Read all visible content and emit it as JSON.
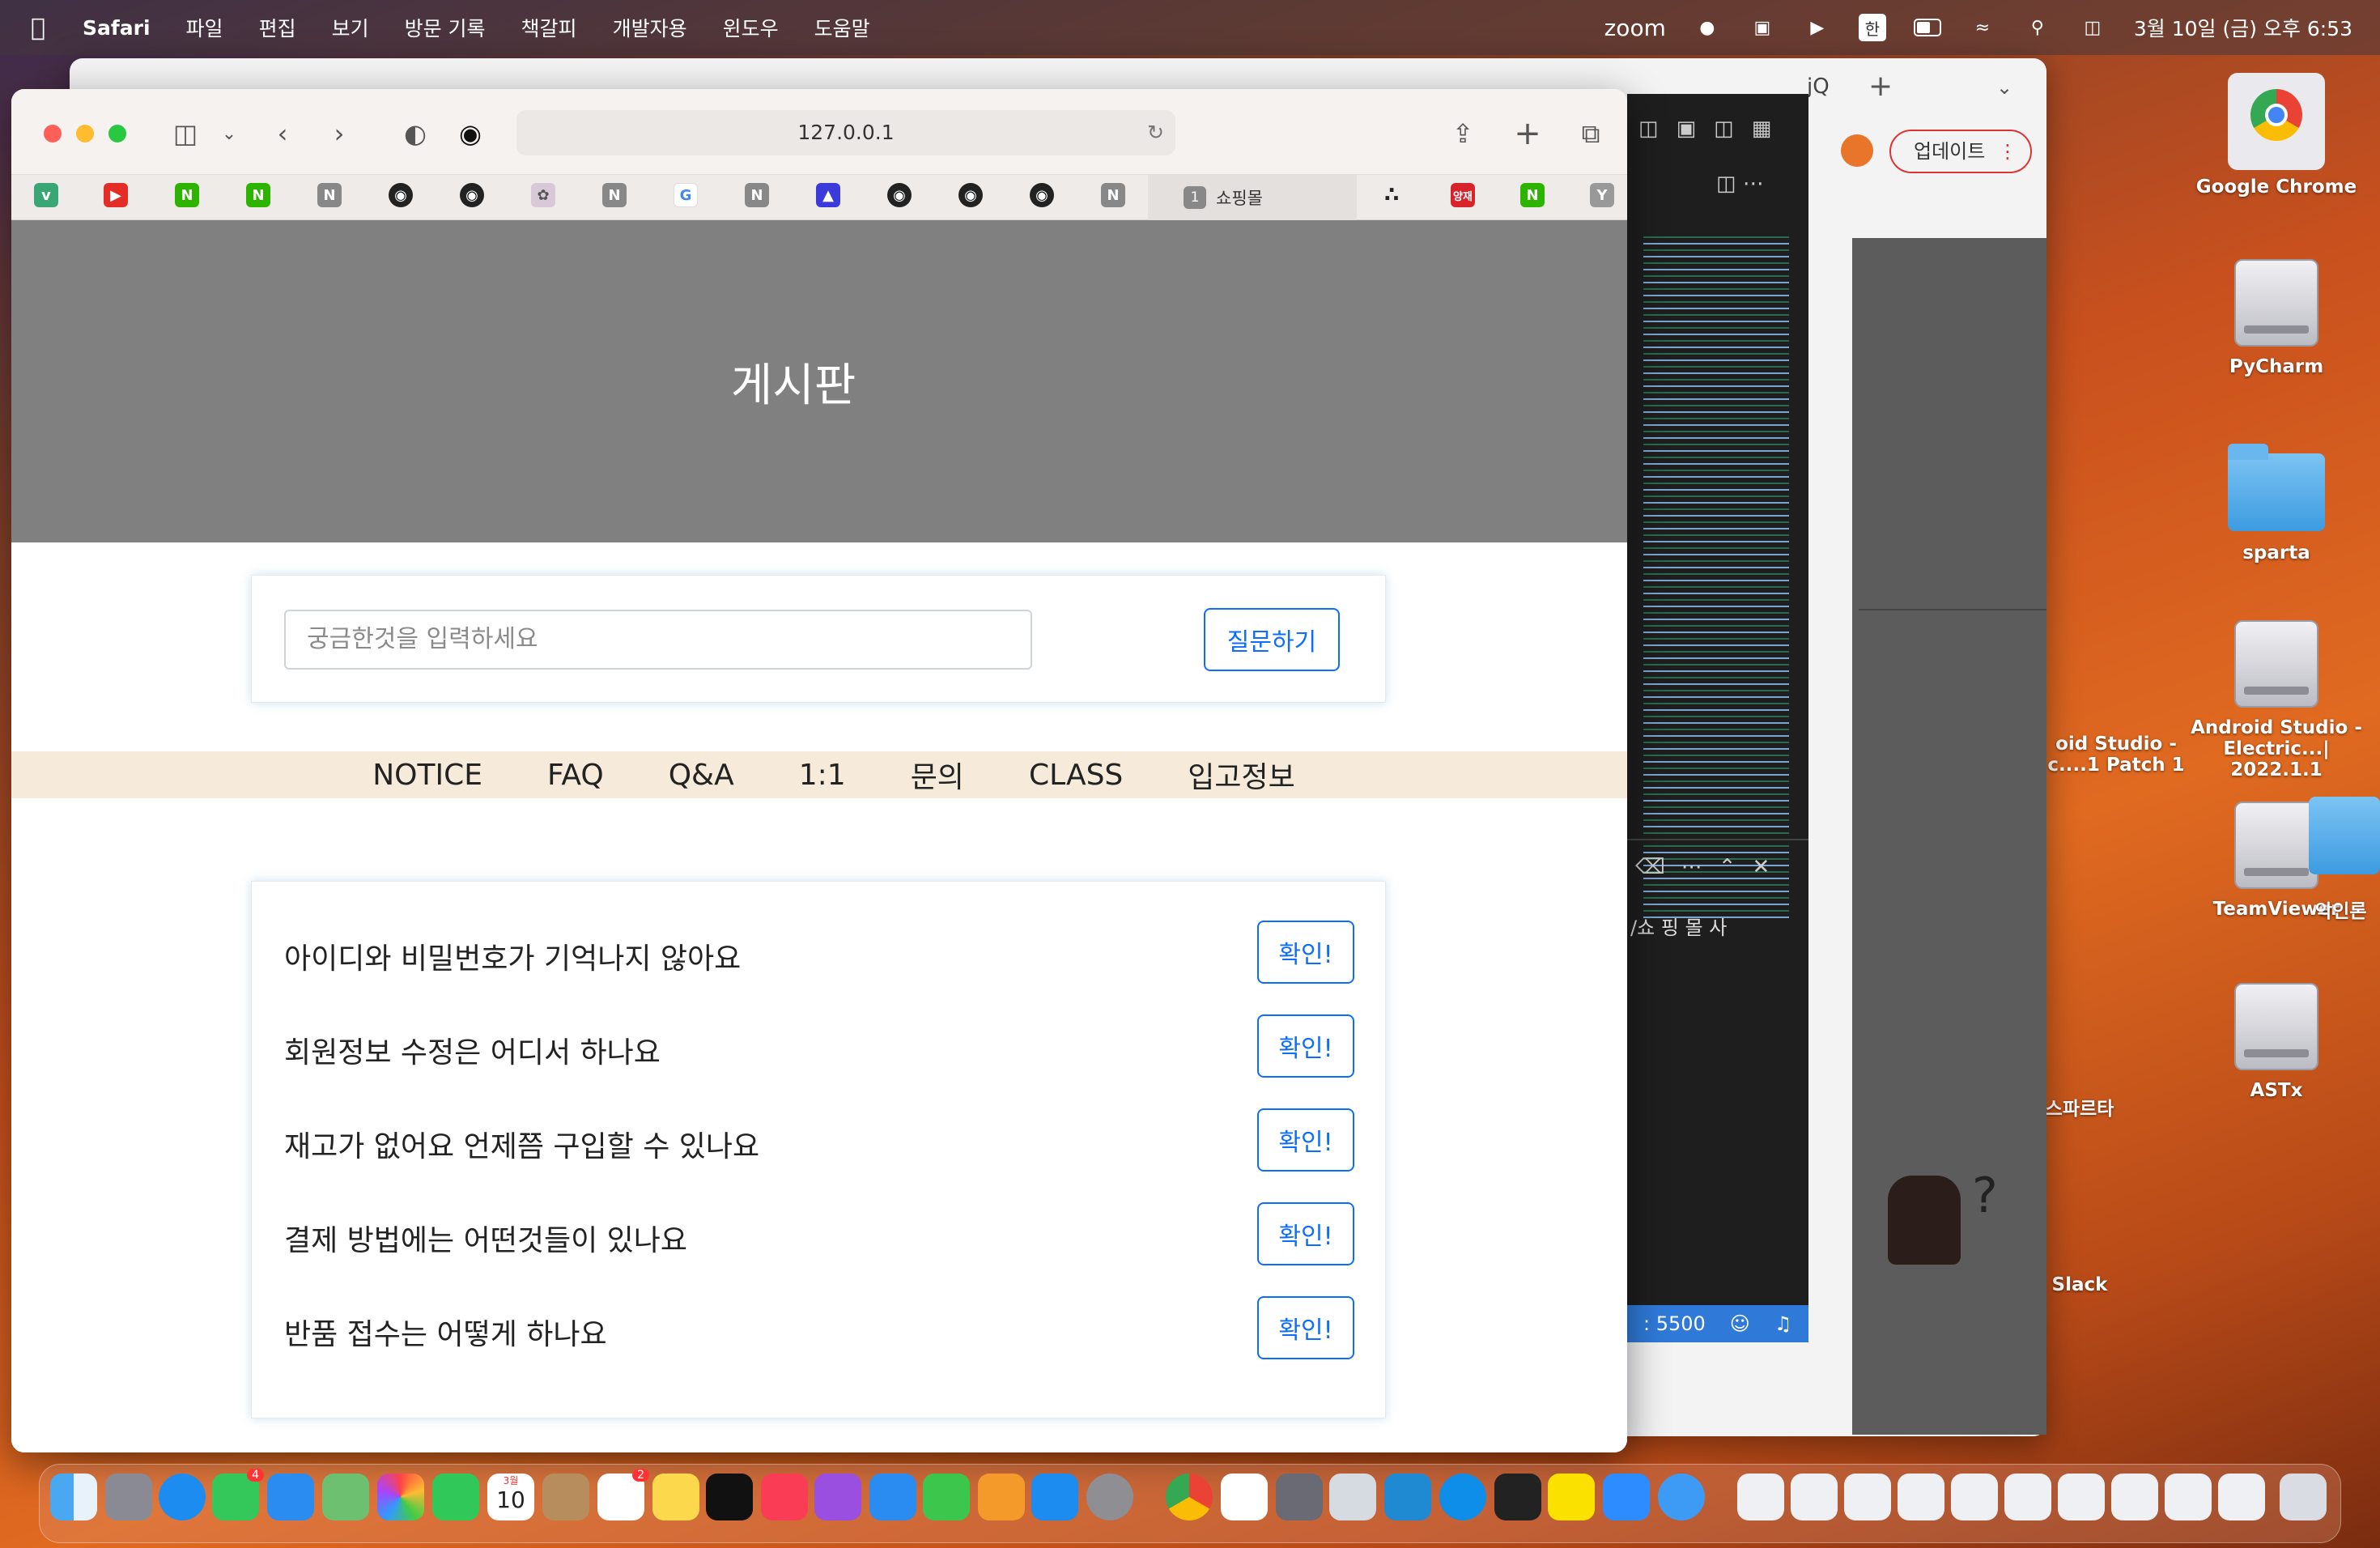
{
  "menubar": {
    "app": "Safari",
    "items": [
      "파일",
      "편집",
      "보기",
      "방문 기록",
      "책갈피",
      "개발자용",
      "윈도우",
      "도움말"
    ],
    "zoom": "zoom",
    "input_method": "한",
    "clock": "3월 10일 (금) 오후 6:53"
  },
  "desktop": {
    "icons": [
      "Google Chrome",
      "PyCharm",
      "sparta",
      "Android Studio - Electric...| 2022.1.1",
      "TeamViewer",
      "ASTx"
    ],
    "partial_icons": [
      "oid Studio - c....1 Patch 1",
      "스파르타",
      "Slack",
      "악인론"
    ]
  },
  "background_browser": {
    "update_label": "업데이트",
    "tab_label": "jQ"
  },
  "vscode": {
    "terminal_text": "/쇼 핑 몰 사",
    "port_label": ": 5500"
  },
  "safari": {
    "url": "127.0.0.1",
    "active_tab": {
      "number": "1",
      "title": "쇼핑몰"
    },
    "favorites": [
      "v",
      "▶",
      "N",
      "N",
      "N",
      "gh",
      "gh",
      "bunny",
      "N",
      "G",
      "N",
      "kr",
      "gh",
      "gh",
      "gh",
      "N"
    ],
    "favorites_right": [
      "dots",
      "양재",
      "N",
      "Y"
    ]
  },
  "page": {
    "hero_title": "게시판",
    "search": {
      "placeholder": "궁금한것을 입력하세요",
      "button": "질문하기"
    },
    "nav": [
      "NOTICE",
      "FAQ",
      "Q&A",
      "1:1",
      "문의",
      "CLASS",
      "입고정보"
    ],
    "faq": [
      {
        "question": "아이디와 비밀번호가 기억나지 않아요",
        "button": "확인!"
      },
      {
        "question": "회원정보 수정은 어디서 하나요",
        "button": "확인!"
      },
      {
        "question": "재고가 없어요 언제쯤 구입할 수 있나요",
        "button": "확인!"
      },
      {
        "question": "결제 방법에는 어떤것들이 있나요",
        "button": "확인!"
      },
      {
        "question": "반품 접수는 어떻게 하나요",
        "button": "확인!"
      }
    ]
  },
  "dock": {
    "calendar_month": "3월",
    "calendar_day": "10",
    "messages_badge": "4",
    "reminders_badge": "2"
  }
}
